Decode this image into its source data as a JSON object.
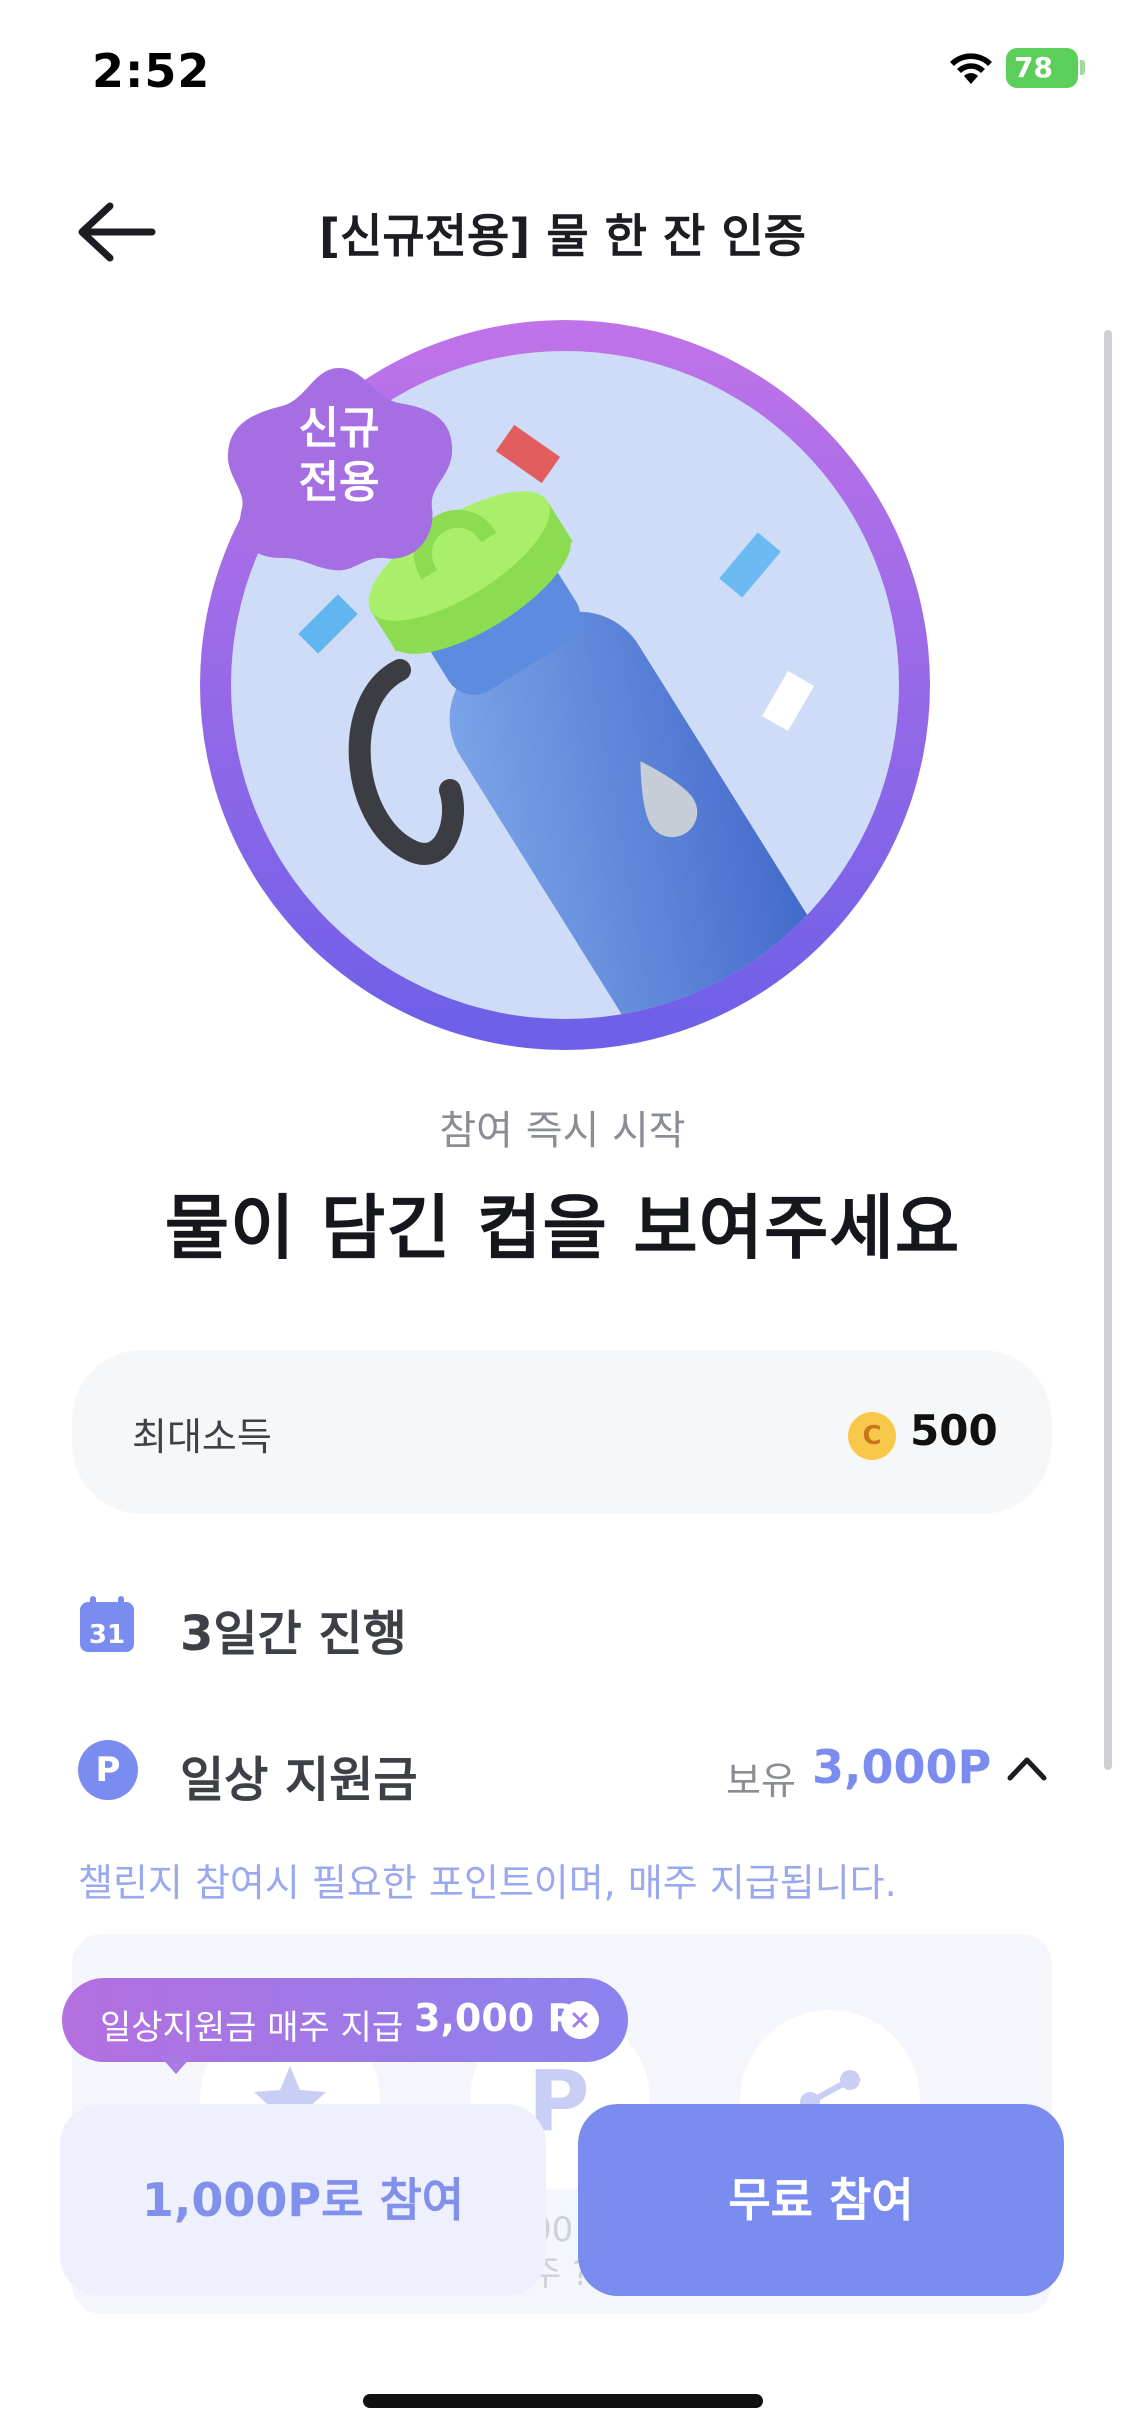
{
  "status_bar": {
    "time": "2:52",
    "battery": "78"
  },
  "header": {
    "title": "[신규전용] 물 한 잔 인증"
  },
  "hero": {
    "badge_line1": "신규",
    "badge_line2": "전용"
  },
  "intro": {
    "subtitle": "참여 즉시 시작",
    "title": "물이 담긴 컵을 보여주세요"
  },
  "income": {
    "label": "최대소득",
    "coin_symbol": "C",
    "value": "500"
  },
  "period": {
    "calendar_day": "31",
    "text": "3일간 진행"
  },
  "support": {
    "icon_letter": "P",
    "label": "일상 지원금",
    "own_label": "보유",
    "own_value": "3,000P",
    "description": "챌린지 참여시 필요한 포인트이며, 매주 지급됩니다."
  },
  "info_panel": {
    "faded_letter": "P",
    "faded_line1": "00",
    "faded_line2": "주 ?"
  },
  "tooltip": {
    "label": "일상지원금 매주 지급",
    "amount": "3,000 P"
  },
  "buttons": {
    "points_join": "1,000P로 참여",
    "free_join": "무료 참여"
  },
  "colors": {
    "accent": "#7b8cf0",
    "accent_light": "#eef0fd",
    "badge_purple": "#a56ee2",
    "battery_green": "#5ccf5a"
  }
}
